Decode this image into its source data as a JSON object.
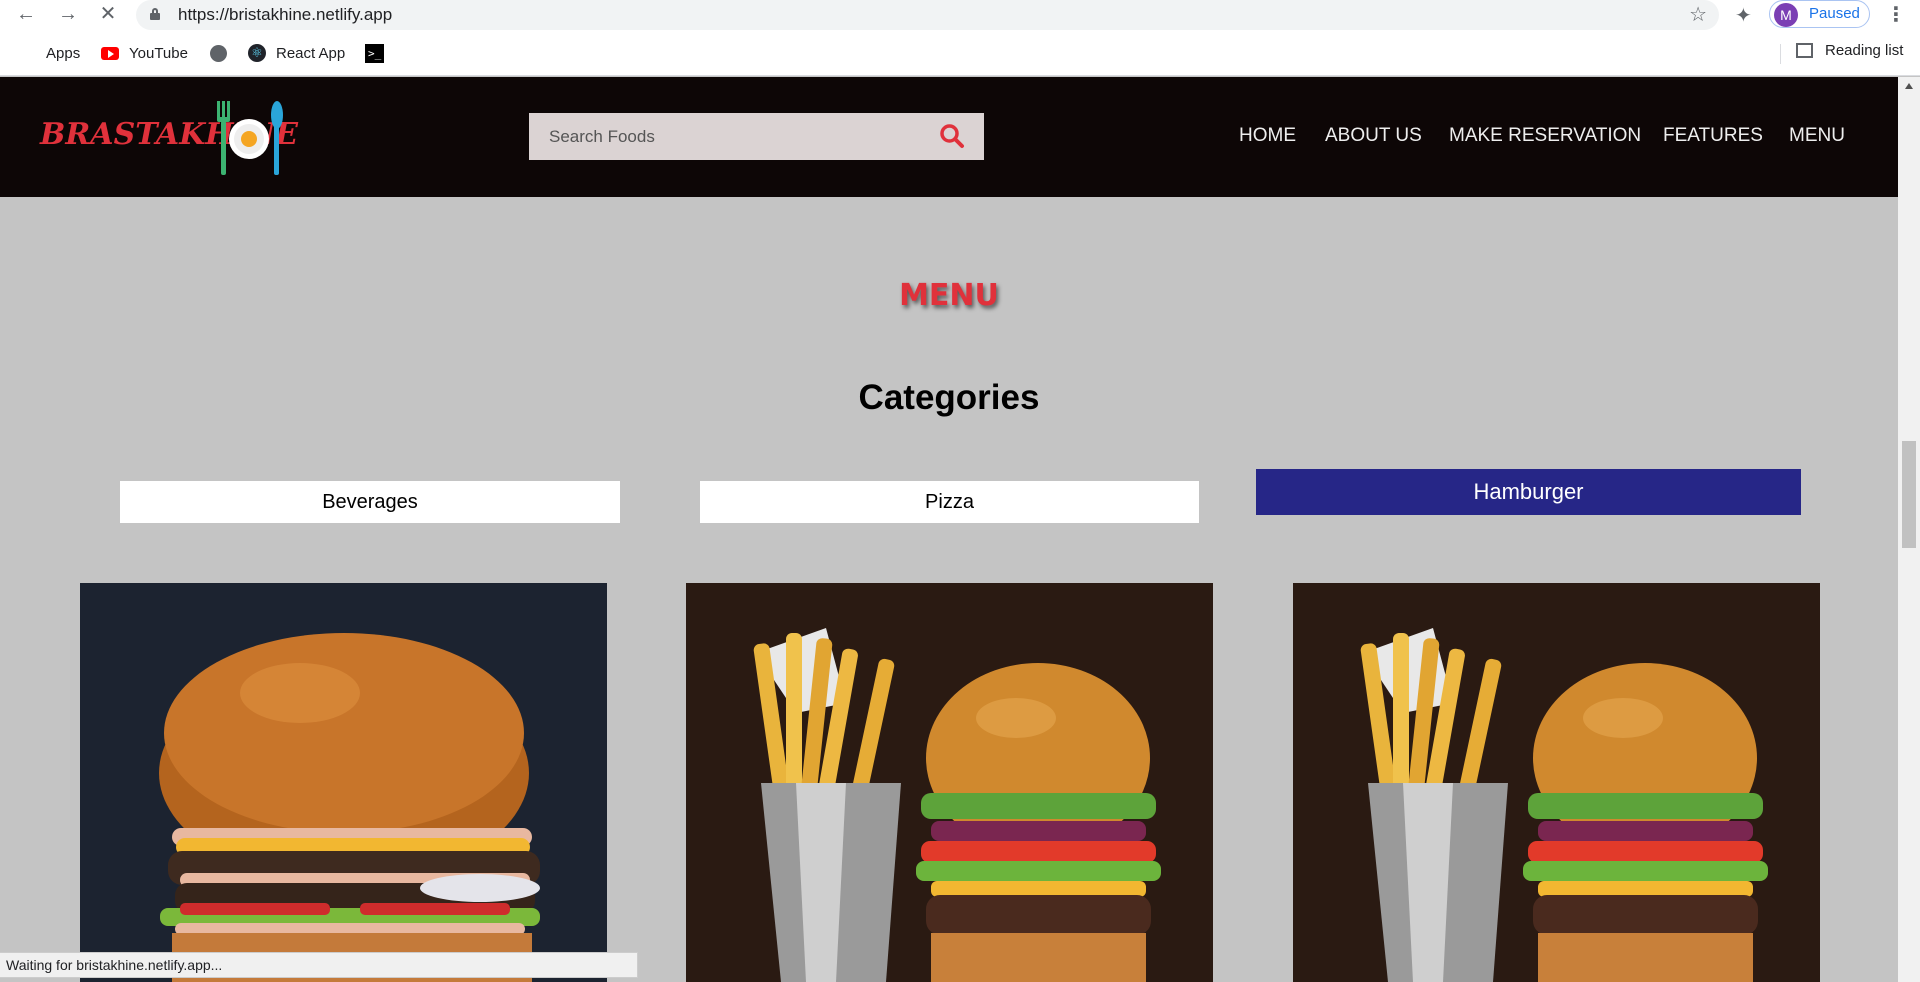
{
  "browser": {
    "url": "https://bristakhine.netlify.app",
    "profile_initial": "M",
    "profile_status": "Paused",
    "bookmarks": [
      "Apps",
      "YouTube",
      "React App"
    ],
    "reading_list": "Reading list",
    "status_text": "Waiting for bristakhine.netlify.app..."
  },
  "site": {
    "logo_text": "BRASTAKHINE",
    "search_placeholder": "Search Foods",
    "nav": [
      "HOME",
      "ABOUT US",
      "MAKE RESERVATION",
      "FEATURES",
      "MENU"
    ]
  },
  "main": {
    "section_title": "MENU",
    "subtitle": "Categories",
    "categories": [
      {
        "label": "Beverages",
        "active": false
      },
      {
        "label": "Pizza",
        "active": false
      },
      {
        "label": "Hamburger",
        "active": true
      }
    ],
    "food_images": [
      "burger-photo",
      "fries-and-burger-photo",
      "fries-and-burger-photo"
    ]
  },
  "colors": {
    "header_bg": "#0d0606",
    "brand_red": "#e0313b",
    "active_category": "#262687",
    "page_bg": "#c4c4c4"
  }
}
